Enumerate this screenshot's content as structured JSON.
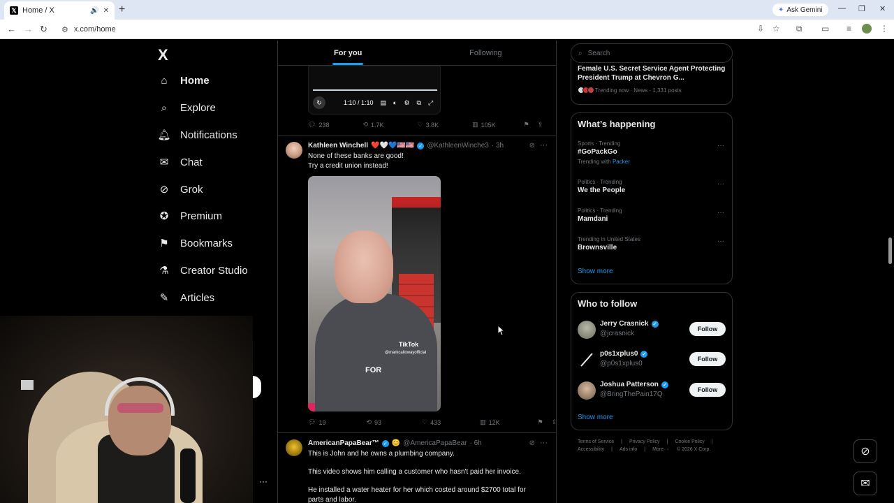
{
  "browser": {
    "tab_title": "Home / X",
    "new_tab": "+",
    "ask_gemini": "Ask Gemini",
    "url": "x.com/home"
  },
  "sidebar": {
    "logo": "X",
    "items": [
      {
        "label": "Home",
        "icon": "home-icon"
      },
      {
        "label": "Explore",
        "icon": "search-icon"
      },
      {
        "label": "Notifications",
        "icon": "bell-icon"
      },
      {
        "label": "Chat",
        "icon": "mail-icon"
      },
      {
        "label": "Grok",
        "icon": "grok-icon"
      },
      {
        "label": "Premium",
        "icon": "premium-icon"
      },
      {
        "label": "Bookmarks",
        "icon": "bookmark-icon"
      },
      {
        "label": "Creator Studio",
        "icon": "flask-icon"
      },
      {
        "label": "Articles",
        "icon": "article-icon"
      }
    ]
  },
  "feed": {
    "tabs": {
      "for_you": "For you",
      "following": "Following"
    },
    "top_video": {
      "time": "1:10 / 1:10"
    },
    "post0_stats": {
      "replies": "238",
      "reposts": "1.7K",
      "likes": "3.8K",
      "views": "105K"
    },
    "post1": {
      "name": "Kathleen Winchell",
      "emojis": "❤️🤍💙🇺🇸🇺🇸",
      "handle": "@KathleenWinche3",
      "time": "· 3h",
      "text_line1": "None of these banks are good!",
      "text_line2": "Try a credit union instead!",
      "video_watermark": "TikTok",
      "video_user": "@markcallowayofficial",
      "video_caption": "FOR",
      "stats": {
        "replies": "19",
        "reposts": "93",
        "likes": "433",
        "views": "12K"
      }
    },
    "post2": {
      "name": "AmericanPapaBear™",
      "handle": "@AmericaPapaBear",
      "time": "· 6h",
      "text_line1": "This is John and he owns a plumbing company.",
      "text_line2": "This video shows him calling a customer who hasn't paid her invoice.",
      "text_line3": "He installed a water heater for her which costed around $2700 total for",
      "text_line4": "parts and labor."
    }
  },
  "right": {
    "search_placeholder": "Search",
    "news": {
      "title": "Female U.S. Secret Service Agent Protecting President Trump at Chevron G...",
      "meta": "Trending now · News · 1,331 posts"
    },
    "happening": {
      "title": "What’s happening",
      "trends": [
        {
          "category": "Sports · Trending",
          "topic": "#GoPackGo",
          "with_prefix": "Trending with",
          "with_link": "Packer"
        },
        {
          "category": "Politics · Trending",
          "topic": "We the People"
        },
        {
          "category": "Politics · Trending",
          "topic": "Mamdani"
        },
        {
          "category": "Trending in United States",
          "topic": "Brownsville"
        }
      ],
      "show_more": "Show more"
    },
    "who_to_follow": {
      "title": "Who to follow",
      "users": [
        {
          "name": "Jerry Crasnick",
          "handle": "@jcrasnick",
          "button": "Follow"
        },
        {
          "name": "p0s1xplus0",
          "handle": "@p0s1xplus0",
          "button": "Follow"
        },
        {
          "name": "Joshua Patterson",
          "handle": "@BringThePain17Q",
          "button": "Follow"
        }
      ],
      "show_more": "Show more"
    },
    "footer": [
      "Terms of Service",
      "|",
      "Privacy Policy",
      "|",
      "Cookie Policy",
      "|",
      "Accessibility",
      "|",
      "Ads info",
      "|",
      "More ···",
      "© 2026 X Corp."
    ]
  },
  "colors": {
    "accent": "#1d9bf0",
    "background": "#000000",
    "border": "#2f3336",
    "muted": "#71767b"
  }
}
